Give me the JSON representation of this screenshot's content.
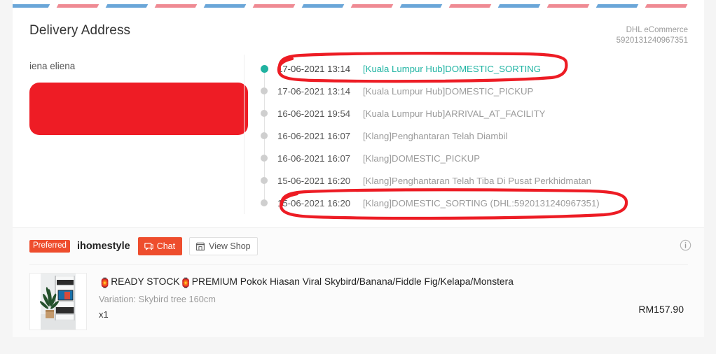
{
  "theme": {
    "accent_orange": "#ee4d2d",
    "active_teal": "#22b5a4",
    "redaction_red": "#ee1c25",
    "annotation_red": "#ed1c24",
    "stripe_blue": "#6aa6d8",
    "stripe_red": "#ef8a93",
    "muted_text": "#9b9b9b",
    "card_bg": "#ffffff",
    "page_bg": "#f5f5f5"
  },
  "stripe": {
    "pattern": [
      "blue",
      "red",
      "blue",
      "red",
      "blue",
      "red",
      "blue",
      "red",
      "blue",
      "red",
      "blue",
      "red",
      "blue",
      "red"
    ]
  },
  "delivery": {
    "title": "Delivery Address",
    "courier_name": "DHL eCommerce",
    "tracking_number": "5920131240967351",
    "recipient_name": "iena eliena",
    "address_redacted": true
  },
  "timeline": {
    "entries": [
      {
        "time": "17-06-2021 13:14",
        "description": "[Kuala Lumpur Hub]DOMESTIC_SORTING",
        "active": true,
        "annotated": true
      },
      {
        "time": "17-06-2021 13:14",
        "description": "[Kuala Lumpur Hub]DOMESTIC_PICKUP",
        "active": false,
        "annotated": false
      },
      {
        "time": "16-06-2021 19:54",
        "description": "[Kuala Lumpur Hub]ARRIVAL_AT_FACILITY",
        "active": false,
        "annotated": false
      },
      {
        "time": "16-06-2021 16:07",
        "description": "[Klang]Penghantaran Telah Diambil",
        "active": false,
        "annotated": false
      },
      {
        "time": "16-06-2021 16:07",
        "description": "[Klang]DOMESTIC_PICKUP",
        "active": false,
        "annotated": false
      },
      {
        "time": "15-06-2021 16:20",
        "description": "[Klang]Penghantaran Telah Tiba Di Pusat Perkhidmatan",
        "active": false,
        "annotated": false
      },
      {
        "time": "15-06-2021 16:20",
        "description": "[Klang]DOMESTIC_SORTING (DHL:5920131240967351)",
        "active": false,
        "annotated": true
      }
    ]
  },
  "shop": {
    "preferred_badge": "Preferred",
    "name": "ihomestyle",
    "chat_label": "Chat",
    "view_shop_label": "View Shop",
    "info_icon": "info-circle-icon",
    "chat_icon": "chat-bubble-icon",
    "shop_icon": "storefront-icon"
  },
  "product": {
    "title_prefix": "READY STOCK",
    "title_rest": "PREMIUM Pokok Hiasan Viral Skybird/Banana/Fiddle Fig/Kelapa/Monstera",
    "title_full": "🏮 READY STOCK 🏮 PREMIUM Pokok Hiasan Viral Skybird/Banana/Fiddle Fig/Kelapa/Monstera",
    "emoji": "🏮",
    "variation": "Variation: Skybird tree 160cm",
    "quantity": "x1",
    "price": "RM157.90",
    "thumbnail_alt": "product-thumbnail"
  }
}
